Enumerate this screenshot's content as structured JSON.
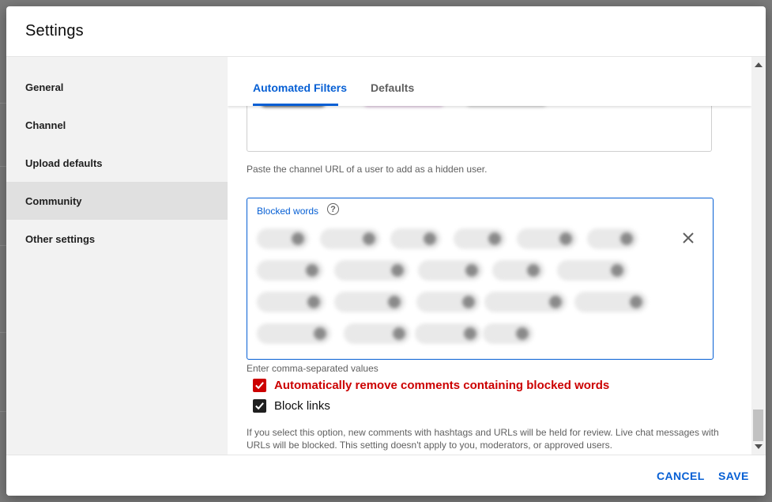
{
  "dialog": {
    "title": "Settings"
  },
  "sidebar": {
    "items": [
      {
        "label": "General"
      },
      {
        "label": "Channel"
      },
      {
        "label": "Upload defaults"
      },
      {
        "label": "Community",
        "active": true
      },
      {
        "label": "Other settings"
      }
    ]
  },
  "tabs": [
    {
      "label": "Automated Filters",
      "active": true
    },
    {
      "label": "Defaults"
    }
  ],
  "hidden_users": {
    "helper": "Paste the channel URL of a user to add as a hidden user."
  },
  "blocked_words": {
    "label": "Blocked words",
    "help_icon": "help-circle-icon",
    "clear_icon": "close-icon",
    "helper": "Enter comma-separated values"
  },
  "options": {
    "auto_remove": {
      "label": "Automatically remove comments containing blocked words",
      "checked": true,
      "color": "#cc0000"
    },
    "block_links": {
      "label": "Block links",
      "checked": true
    },
    "description": "If you select this option, new comments with hashtags and URLs will be held for review. Live chat messages with URLs will be blocked. This setting doesn't apply to you, moderators, or approved users."
  },
  "footer": {
    "cancel_label": "CANCEL",
    "save_label": "SAVE"
  },
  "colors": {
    "accent": "#065fd4",
    "danger": "#cc0000"
  }
}
